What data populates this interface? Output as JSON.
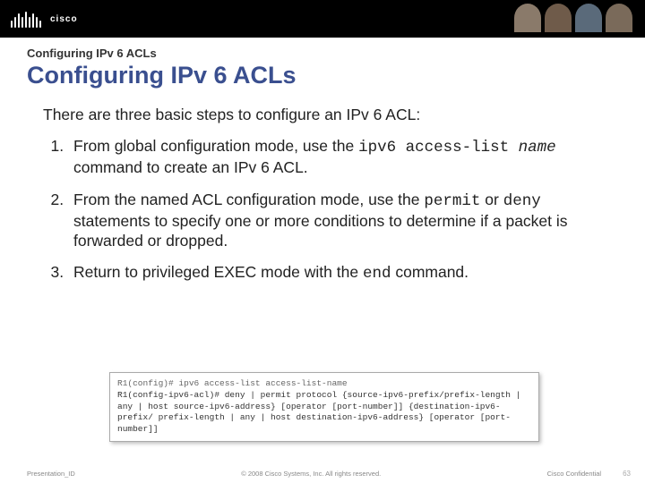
{
  "banner": {
    "logo_text": "cisco"
  },
  "header": {
    "section_label": "Configuring IPv 6 ACLs",
    "title": "Configuring IPv 6 ACLs"
  },
  "intro": "There are three basic steps to configure an IPv 6 ACL:",
  "steps": {
    "s1_a": "From global configuration mode, use the ",
    "s1_cmd": "ipv6 access-list",
    "s1_arg": " name",
    "s1_b": " command to create an IPv 6 ACL.",
    "s2_a": "From the named ACL configuration mode, use the ",
    "s2_cmd1": "permit",
    "s2_mid": " or ",
    "s2_cmd2": "deny",
    "s2_b": " statements to specify one or more conditions to determine if a packet is forwarded or dropped.",
    "s3_a": "Return to privileged EXEC mode with the ",
    "s3_cmd": "end",
    "s3_b": " command."
  },
  "syntax": {
    "line1": "R1(config)# ipv6 access-list access-list-name",
    "line2": "R1(config-ipv6-acl)# deny | permit protocol {source-ipv6-prefix/prefix-length | any | host source-ipv6-address} [operator [port-number]] {destination-ipv6-prefix/ prefix-length | any | host destination-ipv6-address} [operator [port-number]]"
  },
  "footer": {
    "presentation_id": "Presentation_ID",
    "copyright": "© 2008 Cisco Systems, Inc. All rights reserved.",
    "confidential": "Cisco Confidential",
    "page": "63"
  }
}
